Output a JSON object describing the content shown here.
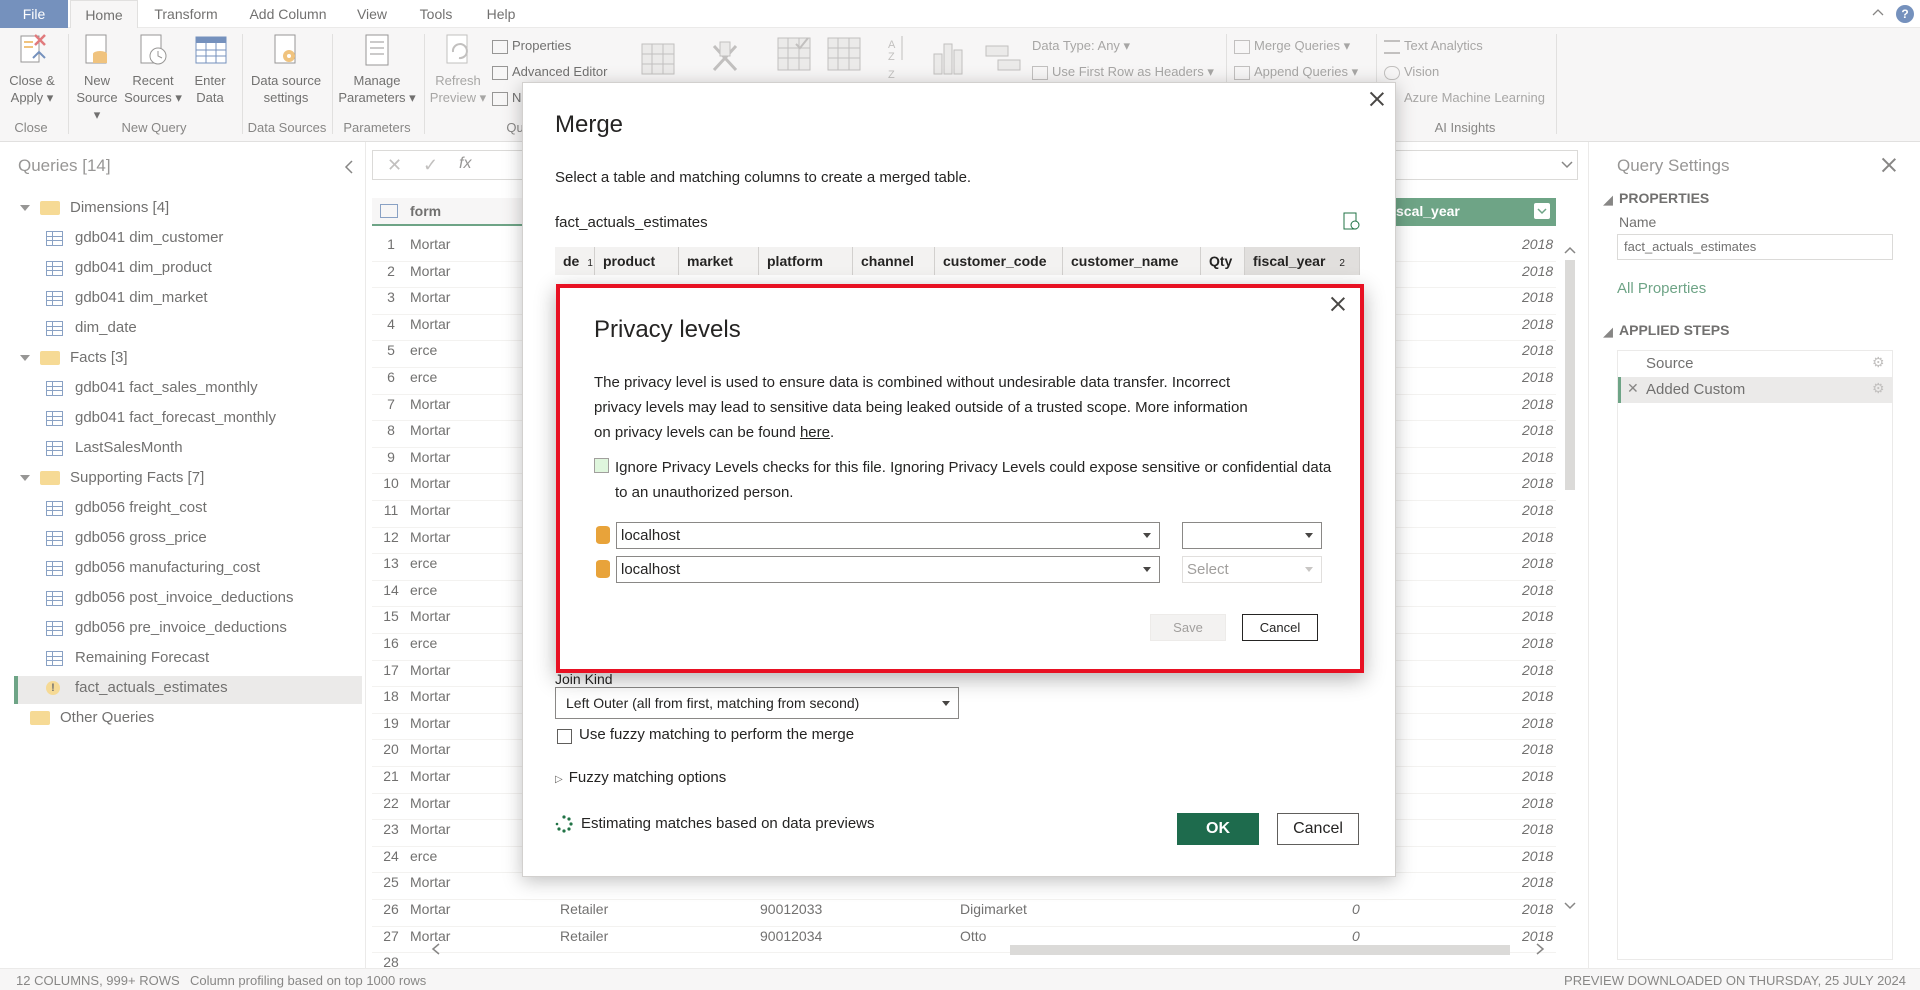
{
  "tabs": {
    "file": "File",
    "home": "Home",
    "transform": "Transform",
    "add_column": "Add Column",
    "view": "View",
    "tools": "Tools",
    "help": "Help"
  },
  "ribbon": {
    "close_apply": [
      "Close &",
      "Apply"
    ],
    "new_source": [
      "New",
      "Source"
    ],
    "recent_sources": [
      "Recent",
      "Sources"
    ],
    "enter_data": [
      "Enter",
      "Data"
    ],
    "data_source_settings": [
      "Data source",
      "settings"
    ],
    "manage_parameters": [
      "Manage",
      "Parameters"
    ],
    "refresh_preview": [
      "Refresh",
      "Preview"
    ],
    "properties": "Properties",
    "advanced_editor": "Advanced Editor",
    "manage_short": "N",
    "data_type": "Data Type: Any",
    "first_row_headers": "Use First Row as Headers",
    "merge_queries": "Merge Queries",
    "append_queries": "Append Queries",
    "text_analytics": "Text Analytics",
    "vision": "Vision",
    "azure_ml": "Azure Machine Learning",
    "groups": {
      "close": "Close",
      "new_query": "New Query",
      "data_sources": "Data Sources",
      "parameters": "Parameters",
      "query": "Qu",
      "ai_insights": "AI Insights"
    }
  },
  "queries": {
    "title": "Queries [14]",
    "groups": [
      {
        "label": "Dimensions [4]",
        "items": [
          "gdb041 dim_customer",
          "gdb041 dim_product",
          "gdb041 dim_market",
          "dim_date"
        ]
      },
      {
        "label": "Facts [3]",
        "items": [
          "gdb041 fact_sales_monthly",
          "gdb041 fact_forecast_monthly",
          "LastSalesMonth"
        ]
      },
      {
        "label": "Supporting Facts [7]",
        "items": [
          "gdb056 freight_cost",
          "gdb056 gross_price",
          "gdb056 manufacturing_cost",
          "gdb056 post_invoice_deductions",
          "gdb056 pre_invoice_deductions",
          "Remaining Forecast",
          "fact_actuals_estimates"
        ]
      }
    ],
    "other": "Other Queries"
  },
  "grid": {
    "col_platform": "form",
    "col_fiscal": "scal_year",
    "rows": [
      {
        "n": "1",
        "p": "Mortar",
        "y": "2018"
      },
      {
        "n": "2",
        "p": "Mortar",
        "y": "2018"
      },
      {
        "n": "3",
        "p": "Mortar",
        "y": "2018"
      },
      {
        "n": "4",
        "p": "Mortar",
        "y": "2018"
      },
      {
        "n": "5",
        "p": "erce",
        "y": "2018"
      },
      {
        "n": "6",
        "p": "erce",
        "y": "2018"
      },
      {
        "n": "7",
        "p": "Mortar",
        "y": "2018"
      },
      {
        "n": "8",
        "p": "Mortar",
        "y": "2018"
      },
      {
        "n": "9",
        "p": "Mortar",
        "y": "2018"
      },
      {
        "n": "10",
        "p": "Mortar",
        "y": "2018"
      },
      {
        "n": "11",
        "p": "Mortar",
        "y": "2018"
      },
      {
        "n": "12",
        "p": "Mortar",
        "y": "2018"
      },
      {
        "n": "13",
        "p": "erce",
        "y": "2018"
      },
      {
        "n": "14",
        "p": "erce",
        "y": "2018"
      },
      {
        "n": "15",
        "p": "Mortar",
        "y": "2018"
      },
      {
        "n": "16",
        "p": "erce",
        "y": "2018"
      },
      {
        "n": "17",
        "p": "Mortar",
        "y": "2018"
      },
      {
        "n": "18",
        "p": "Mortar",
        "y": "2018"
      },
      {
        "n": "19",
        "p": "Mortar",
        "y": "2018"
      },
      {
        "n": "20",
        "p": "Mortar",
        "y": "2018"
      },
      {
        "n": "21",
        "p": "Mortar",
        "y": "2018"
      },
      {
        "n": "22",
        "p": "Mortar",
        "y": "2018"
      },
      {
        "n": "23",
        "p": "Mortar",
        "y": "2018"
      },
      {
        "n": "24",
        "p": "erce",
        "y": "2018"
      },
      {
        "n": "25",
        "p": "Mortar",
        "y": "2018"
      },
      {
        "n": "26",
        "p": "Mortar",
        "y": "2018"
      },
      {
        "n": "27",
        "p": "Mortar",
        "y": "2018"
      },
      {
        "n": "28",
        "p": "",
        "y": ""
      }
    ],
    "row26": {
      "type": "Retailer",
      "code": "90012033",
      "name": "Digimarket",
      "qty": "0"
    },
    "row27": {
      "type": "Retailer",
      "code": "90012034",
      "name": "Otto",
      "qty": "0"
    }
  },
  "settings": {
    "title": "Query Settings",
    "properties": "PROPERTIES",
    "name_label": "Name",
    "name_value": "fact_actuals_estimates",
    "all_properties": "All Properties",
    "applied_steps": "APPLIED STEPS",
    "steps": [
      "Source",
      "Added Custom"
    ]
  },
  "status": {
    "left": "12 COLUMNS, 999+ ROWS",
    "profiling": "Column profiling based on top 1000 rows",
    "right": "PREVIEW DOWNLOADED ON THURSDAY, 25 JULY 2024"
  },
  "merge": {
    "title": "Merge",
    "subtitle": "Select a table and matching columns to create a merged table.",
    "table_name": "fact_actuals_estimates",
    "headers": [
      "de",
      "product",
      "market",
      "platform",
      "channel",
      "customer_code",
      "customer_name",
      "Qty",
      "fiscal_year"
    ],
    "badge1": "1",
    "badge2": "2",
    "join_kind_label": "Join Kind",
    "join_kind": "Left Outer (all from first, matching from second)",
    "fuzzy": "Use fuzzy matching to perform the merge",
    "fuzzy_options": "Fuzzy matching options",
    "estimating": "Estimating matches based on data previews",
    "ok": "OK",
    "cancel": "Cancel"
  },
  "privacy": {
    "title": "Privacy levels",
    "desc1": "The privacy level is used to ensure data is combined without undesirable data transfer. Incorrect",
    "desc2": "privacy levels may lead to sensitive data being leaked outside of a trusted scope. More information",
    "desc3": "on privacy levels can be found ",
    "link": "here",
    "period": ".",
    "ignore1": "Ignore Privacy Levels checks for this file. Ignoring Privacy Levels could expose sensitive or confidential data",
    "ignore2": "to an unauthorized person.",
    "source1": "localhost",
    "source2": "localhost",
    "level1": "",
    "level2_placeholder": "Select",
    "save": "Save",
    "cancel": "Cancel"
  },
  "colors": {
    "accent": "#217346",
    "file_tab": "#2b579a",
    "highlight": "#e81123",
    "folder": "#f2c75c"
  }
}
